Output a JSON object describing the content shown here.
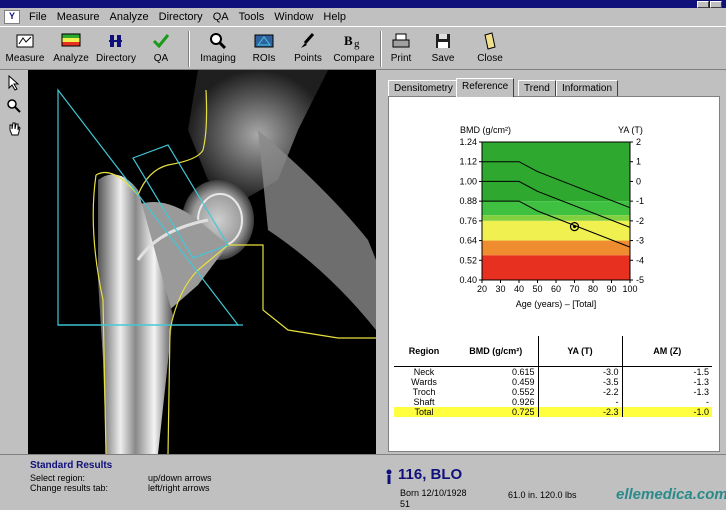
{
  "menu": [
    "File",
    "Measure",
    "Analyze",
    "Directory",
    "QA",
    "Tools",
    "Window",
    "Help"
  ],
  "toolbar": {
    "measure": "Measure",
    "analyze": "Analyze",
    "directory": "Directory",
    "qa": "QA",
    "imaging": "Imaging",
    "rois": "ROIs",
    "points": "Points",
    "compare": "Compare",
    "print": "Print",
    "save": "Save",
    "close": "Close"
  },
  "tabs": [
    "Densitometry",
    "Reference",
    "Trend",
    "Information"
  ],
  "active_tab": "Reference",
  "chart_data": {
    "type": "area",
    "ylabel_left": "BMD (g/cm²)",
    "ylabel_right": "YA (T)",
    "xlabel": "Age (years) – [Total]",
    "x_ticks": [
      20,
      30,
      40,
      50,
      60,
      70,
      80,
      90,
      100
    ],
    "y_ticks": [
      "1.24",
      "1.12",
      "1.00",
      "0.88",
      "0.76",
      "0.64",
      "0.52",
      "0.40"
    ],
    "y_ticks_right": [
      "2",
      "1",
      "0",
      "-1",
      "-2",
      "-3",
      "-4",
      "-5"
    ],
    "xlim": [
      20,
      100
    ],
    "ylim": [
      0.4,
      1.24
    ],
    "bands": [
      {
        "from": 0.88,
        "to": 1.24,
        "color": "#2ea82e"
      },
      {
        "from": 0.795,
        "to": 0.88,
        "color": "#40c040"
      },
      {
        "from": 0.76,
        "to": 0.795,
        "color": "#80d040"
      },
      {
        "from": 0.64,
        "to": 0.76,
        "color": "#f0f050"
      },
      {
        "from": 0.55,
        "to": 0.64,
        "color": "#f08c30"
      },
      {
        "from": 0.4,
        "to": 0.55,
        "color": "#e83020"
      }
    ],
    "curves": [
      {
        "x": [
          20,
          40,
          50,
          100
        ],
        "y": [
          1.12,
          1.12,
          1.06,
          0.84
        ]
      },
      {
        "x": [
          20,
          40,
          50,
          100
        ],
        "y": [
          1.0,
          1.0,
          0.94,
          0.72
        ]
      },
      {
        "x": [
          20,
          40,
          50,
          100
        ],
        "y": [
          0.88,
          0.88,
          0.82,
          0.6
        ]
      }
    ],
    "patient_point": {
      "x": 70,
      "y": 0.725
    }
  },
  "results": {
    "headers": [
      "Region",
      "BMD (g/cm²)",
      "YA (T)",
      "AM (Z)"
    ],
    "rows": [
      {
        "region": "Neck",
        "bmd": "0.615",
        "ya": "-3.0",
        "am": "-1.5"
      },
      {
        "region": "Wards",
        "bmd": "0.459",
        "ya": "-3.5",
        "am": "-1.3"
      },
      {
        "region": "Troch",
        "bmd": "0.552",
        "ya": "-2.2",
        "am": "-1.3"
      },
      {
        "region": "Shaft",
        "bmd": "0.926",
        "ya": "-",
        "am": "-"
      },
      {
        "region": "Total",
        "bmd": "0.725",
        "ya": "-2.3",
        "am": "-1.0"
      }
    ]
  },
  "status": {
    "title": "Standard Results",
    "line1_key": "Select region:",
    "line1_val": "up/down arrows",
    "line2_key": "Change results tab:",
    "line2_val": "left/right arrows"
  },
  "patient": {
    "id_name": "116, BLO",
    "born": "Born 12/10/1928",
    "number": "51",
    "height_weight": "61.0 in.   120.0 lbs"
  },
  "watermark": "ellemedica.com",
  "colors": {
    "titlebar": "#10107a",
    "highlight": "#ffff40",
    "roi": "#40c8d8",
    "edge": "#e8e040"
  }
}
